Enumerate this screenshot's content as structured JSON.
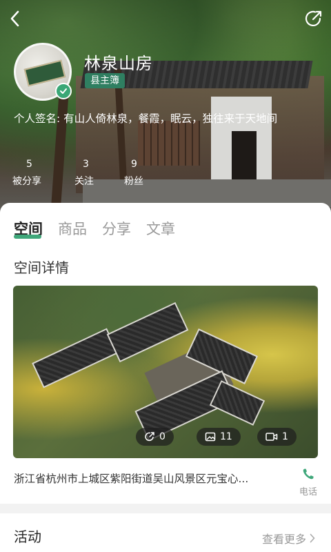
{
  "profile": {
    "name": "林泉山房",
    "badge": "县主簿",
    "bio": "个人签名: 有山人倚林泉，餐霞，眠云，独往来于天地间"
  },
  "stats": [
    {
      "value": "5",
      "label": "被分享"
    },
    {
      "value": "3",
      "label": "关注"
    },
    {
      "value": "9",
      "label": "粉丝"
    }
  ],
  "tabs": [
    {
      "label": "空间"
    },
    {
      "label": "商品"
    },
    {
      "label": "分享"
    },
    {
      "label": "文章"
    }
  ],
  "section": {
    "title": "空间详情"
  },
  "media": {
    "shares": "0",
    "images": "11",
    "videos": "1"
  },
  "address": "浙江省杭州市上城区紫阳街道吴山风景区元宝心...",
  "phone": {
    "label": "电话"
  },
  "activity": {
    "title": "活动",
    "more": "查看更多"
  },
  "colors": {
    "accent": "#3fa77a",
    "badge": "#2f7f61"
  }
}
